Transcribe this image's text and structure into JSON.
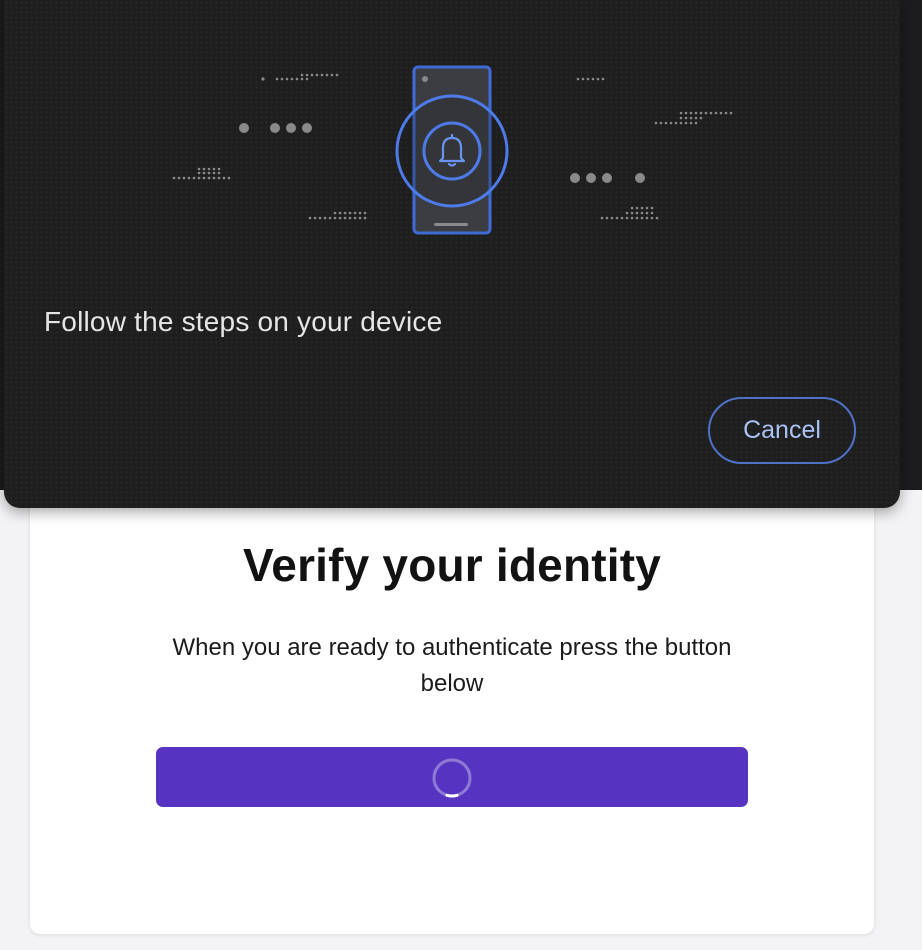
{
  "card": {
    "title": "Verify your identity",
    "description": "When you are ready to authenticate press the button below",
    "verify_button": {
      "state": "loading",
      "icon": "spinner-icon"
    }
  },
  "overlay": {
    "illustration": {
      "device_icon": "phone-icon",
      "notification_icon": "bell-icon"
    },
    "message": "Follow the steps on your device",
    "cancel_label": "Cancel"
  },
  "colors": {
    "overlay_bg": "#1e1e1e",
    "accent_blue": "#4f72c9",
    "button_purple": "#5634c1",
    "page_bg": "#f3f3f5"
  }
}
